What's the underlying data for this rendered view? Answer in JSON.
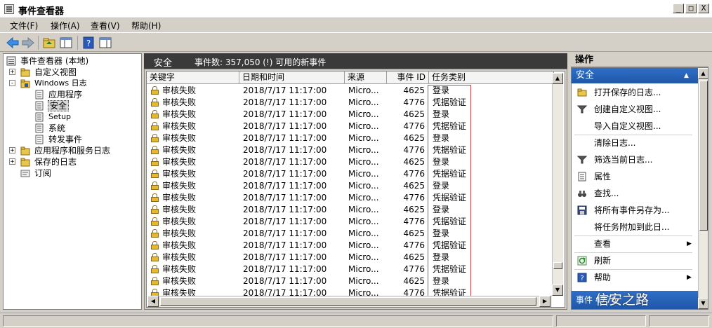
{
  "window": {
    "title": "事件查看器",
    "controls": [
      "_",
      "□",
      "X"
    ]
  },
  "menu": [
    "文件(F)",
    "操作(A)",
    "查看(V)",
    "帮助(H)"
  ],
  "tree": {
    "root": "事件查看器 (本地)",
    "custom_views": "自定义视图",
    "windows_logs": "Windows 日志",
    "children": [
      "应用程序",
      "安全",
      "Setup",
      "系统",
      "转发事件"
    ],
    "app_service_logs": "应用程序和服务日志",
    "saved_logs": "保存的日志",
    "subscriptions": "订阅"
  },
  "center": {
    "log_name": "安全",
    "event_count": "事件数: 357,050 (!) 可用的新事件",
    "columns": [
      "关键字",
      "日期和时间",
      "来源",
      "事件 ID",
      "任务类别"
    ],
    "rows": [
      [
        "审核失败",
        "2018/7/17 11:17:00",
        "Micro...",
        "4625",
        "登录"
      ],
      [
        "审核失败",
        "2018/7/17 11:17:00",
        "Micro...",
        "4776",
        "凭据验证"
      ],
      [
        "审核失败",
        "2018/7/17 11:17:00",
        "Micro...",
        "4625",
        "登录"
      ],
      [
        "审核失败",
        "2018/7/17 11:17:00",
        "Micro...",
        "4776",
        "凭据验证"
      ],
      [
        "审核失败",
        "2018/7/17 11:17:00",
        "Micro...",
        "4625",
        "登录"
      ],
      [
        "审核失败",
        "2018/7/17 11:17:00",
        "Micro...",
        "4776",
        "凭据验证"
      ],
      [
        "审核失败",
        "2018/7/17 11:17:00",
        "Micro...",
        "4625",
        "登录"
      ],
      [
        "审核失败",
        "2018/7/17 11:17:00",
        "Micro...",
        "4776",
        "凭据验证"
      ],
      [
        "审核失败",
        "2018/7/17 11:17:00",
        "Micro...",
        "4625",
        "登录"
      ],
      [
        "审核失败",
        "2018/7/17 11:17:00",
        "Micro...",
        "4776",
        "凭据验证"
      ],
      [
        "审核失败",
        "2018/7/17 11:17:00",
        "Micro...",
        "4625",
        "登录"
      ],
      [
        "审核失败",
        "2018/7/17 11:17:00",
        "Micro...",
        "4776",
        "凭据验证"
      ],
      [
        "审核失败",
        "2018/7/17 11:17:00",
        "Micro...",
        "4625",
        "登录"
      ],
      [
        "审核失败",
        "2018/7/17 11:17:00",
        "Micro...",
        "4776",
        "凭据验证"
      ],
      [
        "审核失败",
        "2018/7/17 11:17:00",
        "Micro...",
        "4625",
        "登录"
      ],
      [
        "审核失败",
        "2018/7/17 11:17:00",
        "Micro...",
        "4776",
        "凭据验证"
      ],
      [
        "审核失败",
        "2018/7/17 11:17:00",
        "Micro...",
        "4625",
        "登录"
      ],
      [
        "审核失败",
        "2018/7/17 11:17:00",
        "Micro...",
        "4776",
        "凭据验证"
      ]
    ]
  },
  "actions": {
    "header": "操作",
    "section": "安全",
    "items": [
      {
        "label": "打开保存的日志...",
        "icon": "folder-open-icon"
      },
      {
        "label": "创建自定义视图...",
        "icon": "filter-icon"
      },
      {
        "label": "导入自定义视图...",
        "icon": ""
      },
      {
        "label": "清除日志...",
        "icon": ""
      },
      {
        "label": "筛选当前日志...",
        "icon": "filter-icon"
      },
      {
        "label": "属性",
        "icon": "properties-icon"
      },
      {
        "label": "查找...",
        "icon": "binoculars-icon"
      },
      {
        "label": "将所有事件另存为...",
        "icon": "save-icon"
      },
      {
        "label": "将任务附加到此日...",
        "icon": ""
      },
      {
        "label": "查看",
        "icon": "",
        "submenu": true
      },
      {
        "label": "刷新",
        "icon": "refresh-icon"
      },
      {
        "label": "帮助",
        "icon": "help-icon",
        "submenu": true
      }
    ],
    "bottom_section": "事件 4776"
  },
  "watermark": "信安之路",
  "colors": {
    "header_dark": "#3a3a3a",
    "section_blue": "#2f6fc8",
    "task_highlight_border": "#d04040",
    "lock_gold": "#e7b82d"
  }
}
